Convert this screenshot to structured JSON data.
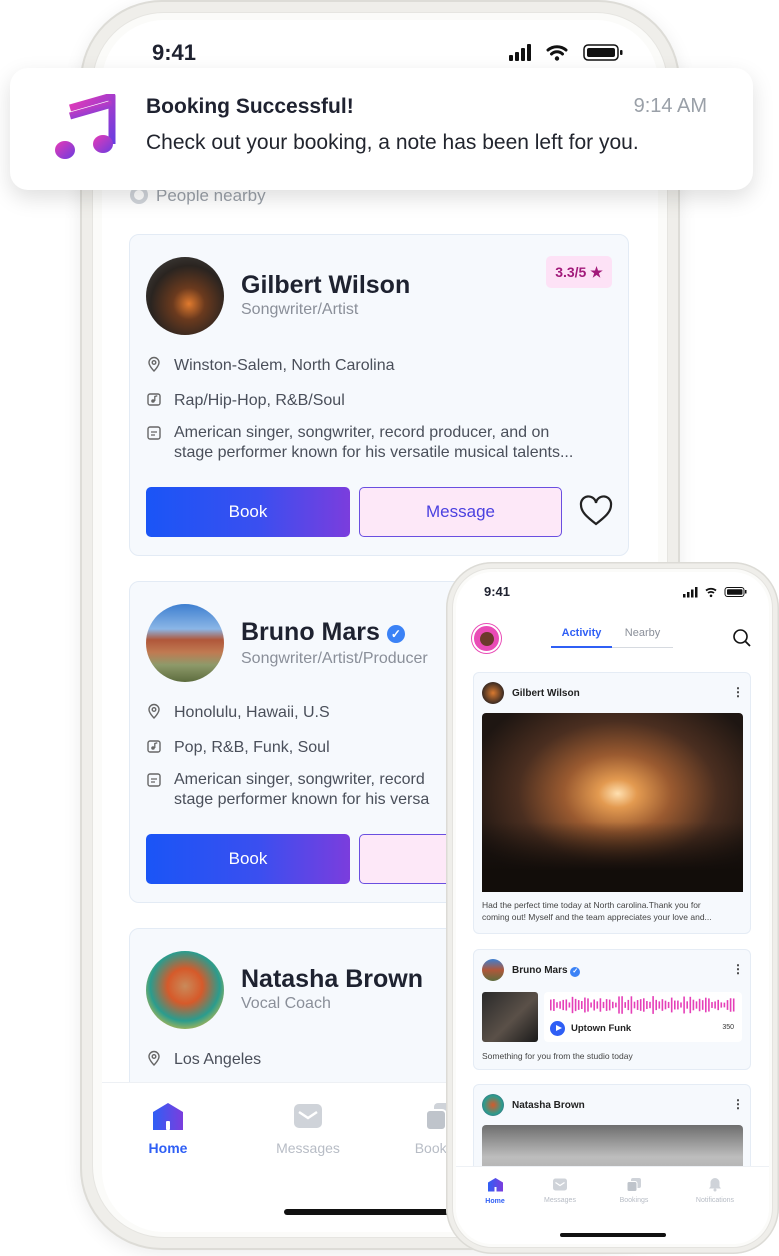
{
  "notification": {
    "title": "Booking Successful!",
    "time": "9:14 AM",
    "body": "Check out your booking, a note has been left for you.",
    "icon": "music-note-icon"
  },
  "main_phone": {
    "status_time": "9:41",
    "section_label": "People nearby",
    "profiles": [
      {
        "name": "Gilbert Wilson",
        "role": "Songwriter/Artist",
        "rating": "3.3/5",
        "location": "Winston-Salem, North Carolina",
        "genres": "Rap/Hip-Hop, R&B/Soul",
        "bio_line1": "American singer, songwriter, record producer, and on",
        "bio_line2": "stage performer known for his versatile musical talents...",
        "book_label": "Book",
        "message_label": "Message"
      },
      {
        "name": "Bruno Mars",
        "role": "Songwriter/Artist/Producer",
        "verified": true,
        "location": "Honolulu, Hawaii, U.S",
        "genres": "Pop, R&B, Funk, Soul",
        "bio_line1": "American singer, songwriter, record",
        "bio_line2": "stage performer known for his versa",
        "book_label": "Book",
        "message_label": "Me"
      },
      {
        "name": "Natasha Brown",
        "role": "Vocal Coach",
        "location": "Los Angeles"
      }
    ],
    "nav": [
      {
        "label": "Home",
        "icon": "home-icon",
        "active": true
      },
      {
        "label": "Messages",
        "icon": "message-icon"
      },
      {
        "label": "Booking",
        "icon": "bookings-icon"
      }
    ]
  },
  "second_phone": {
    "status_time": "9:41",
    "tabs": [
      {
        "label": "Activity",
        "active": true
      },
      {
        "label": "Nearby"
      }
    ],
    "feed": [
      {
        "name": "Gilbert Wilson",
        "caption_line1": "Had the perfect time today at North carolina.Thank you for",
        "caption_line2": "coming out! Myself and the team appreciates your love and..."
      },
      {
        "name": "Bruno Mars",
        "verified": true,
        "track_title": "Uptown Funk",
        "track_count": "350",
        "caption_line1": "Something for you from the studio today"
      },
      {
        "name": "Natasha Brown"
      }
    ],
    "nav": [
      {
        "label": "Home",
        "icon": "home-icon",
        "active": true
      },
      {
        "label": "Messages",
        "icon": "message-icon"
      },
      {
        "label": "Bookings",
        "icon": "bookings-icon"
      },
      {
        "label": "Notifications",
        "icon": "bell-icon"
      }
    ]
  },
  "colors": {
    "accent_blue": "#2f5ff5",
    "accent_purple": "#7b3ddd",
    "accent_pink": "#e53fb8",
    "rating_bg": "#fde2f6",
    "rating_text": "#a21a7a"
  }
}
